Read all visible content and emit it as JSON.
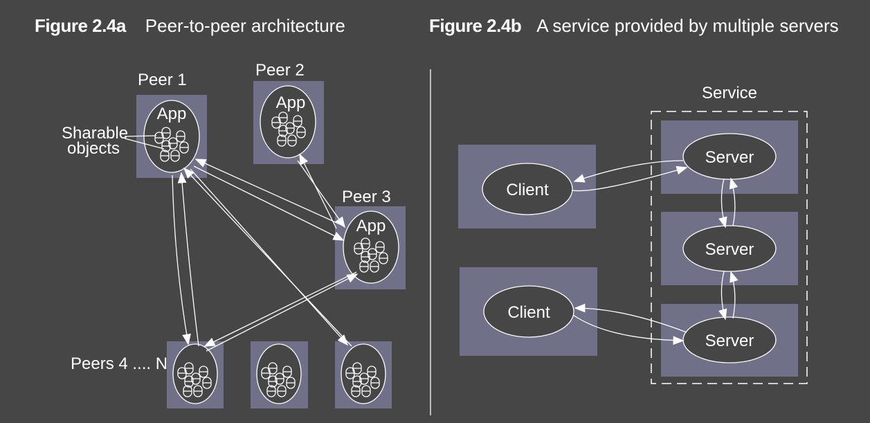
{
  "colors": {
    "background": "#464646",
    "box": "#707088",
    "ellipse_fill": "#464646",
    "line": "#ffffff"
  },
  "figure_a": {
    "number": "Figure 2.4a",
    "title": "Peer-to-peer architecture",
    "annotation": [
      "Sharable",
      "objects"
    ],
    "peers": [
      {
        "id": "peer1",
        "label": "Peer 1",
        "app_label": "App"
      },
      {
        "id": "peer2",
        "label": "Peer 2",
        "app_label": "App"
      },
      {
        "id": "peer3",
        "label": "Peer 3",
        "app_label": "App"
      },
      {
        "id": "peer4",
        "label": "Peers 4 .... N",
        "app_label": ""
      },
      {
        "id": "peer5",
        "label": "",
        "app_label": ""
      },
      {
        "id": "peer6",
        "label": "",
        "app_label": ""
      }
    ],
    "connections": [
      {
        "from": "peer1",
        "to": "peer3",
        "bidirectional": true
      },
      {
        "from": "peer2",
        "to": "peer3",
        "bidirectional": true
      },
      {
        "from": "peer1",
        "to": "peer4",
        "bidirectional": true
      },
      {
        "from": "peer1",
        "to": "peer6",
        "bidirectional": true
      },
      {
        "from": "peer3",
        "to": "peer4",
        "bidirectional": true
      }
    ]
  },
  "figure_b": {
    "number": "Figure 2.4b",
    "title": "A service provided by multiple servers",
    "service_label": "Service",
    "clients": [
      {
        "id": "client1",
        "label": "Client"
      },
      {
        "id": "client2",
        "label": "Client"
      }
    ],
    "servers": [
      {
        "id": "server1",
        "label": "Server"
      },
      {
        "id": "server2",
        "label": "Server"
      },
      {
        "id": "server3",
        "label": "Server"
      }
    ],
    "connections": [
      {
        "from": "client1",
        "to": "server1",
        "bidirectional": true
      },
      {
        "from": "client2",
        "to": "server3",
        "bidirectional": true
      },
      {
        "from": "server1",
        "to": "server2",
        "bidirectional": true
      },
      {
        "from": "server2",
        "to": "server3",
        "bidirectional": true
      }
    ]
  }
}
